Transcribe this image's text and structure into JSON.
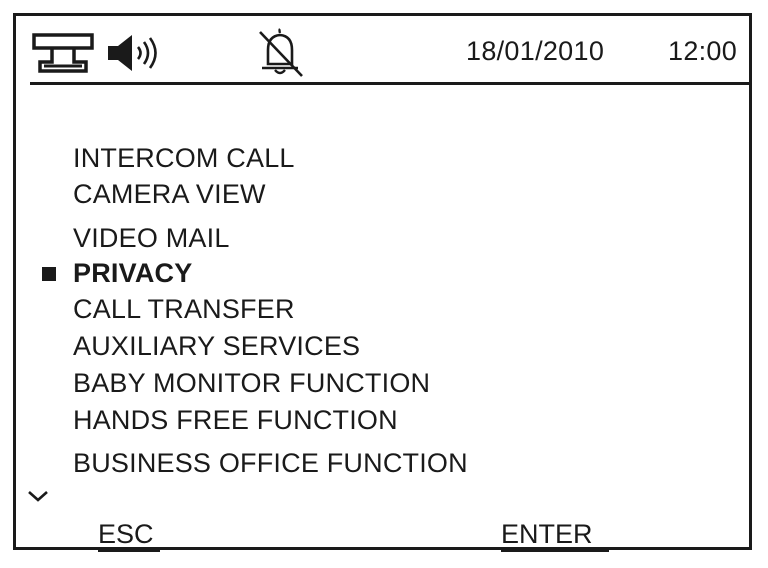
{
  "status_bar": {
    "intercom_icon": "intercom-handset-icon",
    "speaker_icon": "speaker-volume-icon",
    "bell_icon": "bell-off-icon",
    "date": "18/01/2010",
    "time": "12:00"
  },
  "menu": {
    "selected_index": 3,
    "items": [
      {
        "label": "INTERCOM CALL"
      },
      {
        "label": "CAMERA VIEW"
      },
      {
        "label": "VIDEO MAIL"
      },
      {
        "label": "PRIVACY"
      },
      {
        "label": "CALL TRANSFER"
      },
      {
        "label": "AUXILIARY SERVICES"
      },
      {
        "label": "BABY MONITOR FUNCTION"
      },
      {
        "label": "HANDS FREE FUNCTION"
      },
      {
        "label": "BUSINESS OFFICE FUNCTION"
      }
    ],
    "scroll_icon": "chevron-down-icon"
  },
  "softkeys": {
    "esc_label": "ESC",
    "enter_label": "ENTER"
  },
  "colors": {
    "foreground": "#1a1a1a",
    "background": "#ffffff"
  }
}
